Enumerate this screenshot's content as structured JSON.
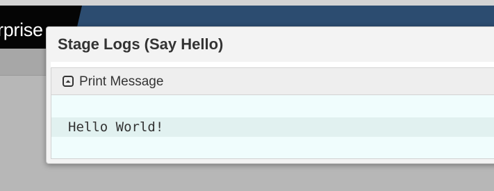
{
  "app": {
    "brand_text": "rprise"
  },
  "modal": {
    "title": "Stage Logs (Say Hello)",
    "step": {
      "icon": "collapse-icon",
      "title": "Print Message",
      "log_lines": [
        "Hello World!"
      ]
    }
  },
  "colors": {
    "header_blue": "#2c4c70",
    "brand_black": "#050505",
    "log_background": "#f0fdfd",
    "log_line_highlight": "#e1f1f0"
  }
}
